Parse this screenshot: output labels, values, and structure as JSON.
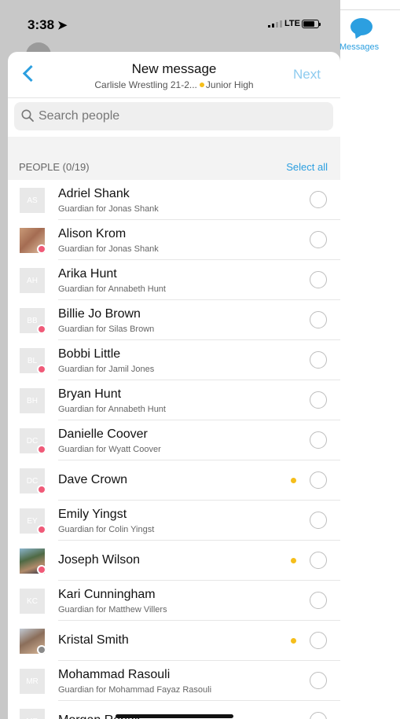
{
  "status_bar": {
    "time": "3:38",
    "network": "LTE"
  },
  "side_panel": {
    "messages_label": "Messages"
  },
  "header": {
    "title": "New message",
    "subtitle_team": "Carlisle Wrestling 21-2...",
    "subtitle_group": "Junior High",
    "next_label": "Next"
  },
  "search": {
    "placeholder": "Search people"
  },
  "section": {
    "label": "PEOPLE (0/19)",
    "select_all": "Select all"
  },
  "people": [
    {
      "initials": "AS",
      "name": "Adriel Shank",
      "role": "Guardian for Jonas Shank",
      "badge": "",
      "online": false
    },
    {
      "initials": "",
      "photo": "photo-a",
      "name": "Alison Krom",
      "role": "Guardian for Jonas Shank",
      "badge": "pink",
      "online": false
    },
    {
      "initials": "AH",
      "name": "Arika Hunt",
      "role": "Guardian for Annabeth Hunt",
      "badge": "",
      "online": false
    },
    {
      "initials": "BB",
      "name": "Billie Jo Brown",
      "role": "Guardian for Silas Brown",
      "badge": "pink",
      "online": false
    },
    {
      "initials": "BL",
      "name": "Bobbi Little",
      "role": "Guardian for Jamil Jones",
      "badge": "pink",
      "online": false
    },
    {
      "initials": "BH",
      "name": "Bryan Hunt",
      "role": "Guardian for Annabeth Hunt",
      "badge": "",
      "online": false
    },
    {
      "initials": "DC",
      "name": "Danielle Coover",
      "role": "Guardian for Wyatt Coover",
      "badge": "pink",
      "online": false
    },
    {
      "initials": "DC",
      "name": "Dave Crown",
      "role": "",
      "badge": "pink",
      "online": true
    },
    {
      "initials": "EY",
      "name": "Emily Yingst",
      "role": "Guardian for Colin Yingst",
      "badge": "pink",
      "online": false
    },
    {
      "initials": "",
      "photo": "photo-b",
      "name": "Joseph Wilson",
      "role": "",
      "badge": "pink",
      "online": true
    },
    {
      "initials": "KC",
      "name": "Kari Cunningham",
      "role": "Guardian for Matthew Villers",
      "badge": "",
      "online": false
    },
    {
      "initials": "",
      "photo": "photo-c",
      "name": "Kristal Smith",
      "role": "",
      "badge": "gray",
      "online": true
    },
    {
      "initials": "MR",
      "name": "Mohammad Rasouli",
      "role": "Guardian for Mohammad Fayaz Rasouli",
      "badge": "",
      "online": false
    },
    {
      "initials": "MR",
      "name": "Morgan Rehak",
      "role": "",
      "badge": "",
      "online": false
    }
  ]
}
